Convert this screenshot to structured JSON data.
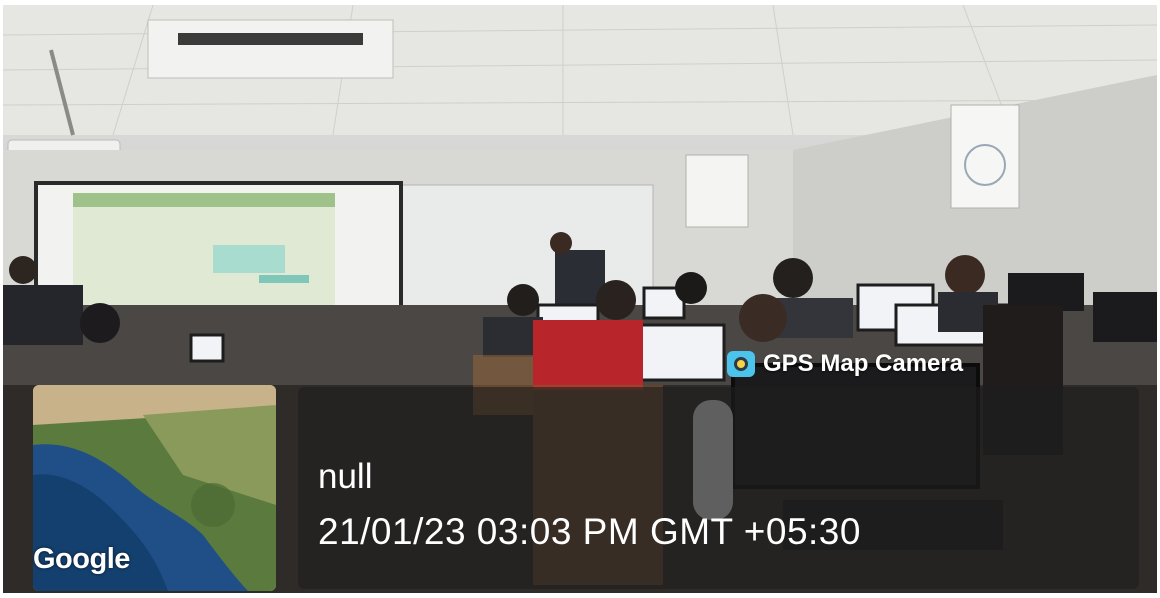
{
  "scene": {
    "description_free": true
  },
  "overlay": {
    "app_label": "GPS Map Camera",
    "app_icon": "gps-map-camera-logo-icon",
    "location_text": "null",
    "datetime_text": "21/01/23 03:03 PM GMT +05:30",
    "map_attribution": "Google"
  },
  "colors": {
    "overlay_background": "#1e1e1e",
    "text": "#ffffff",
    "logo_bg": "#4cc3ea"
  }
}
